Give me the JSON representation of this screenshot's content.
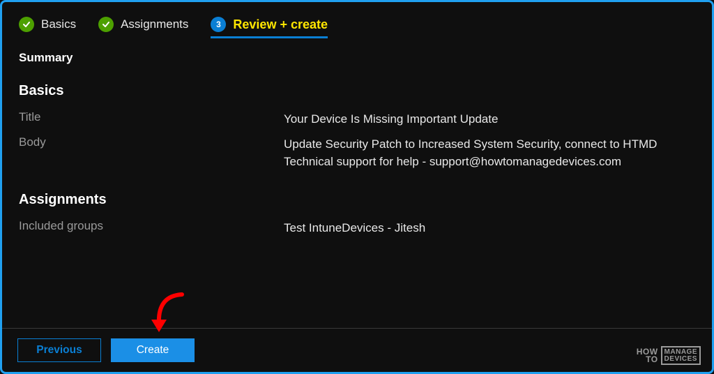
{
  "steps": {
    "basics": "Basics",
    "assignments": "Assignments",
    "review": "Review + create",
    "active_num": "3"
  },
  "summary": {
    "heading": "Summary",
    "basics_section": "Basics",
    "title_label": "Title",
    "title_value": "Your Device Is Missing Important Update",
    "body_label": "Body",
    "body_value": "Update Security Patch to Increased System Security, connect to HTMD Technical support for help - support@howtomanagedevices.com",
    "assignments_section": "Assignments",
    "included_label": "Included groups",
    "included_value": "Test IntuneDevices - Jitesh"
  },
  "footer": {
    "previous": "Previous",
    "create": "Create"
  },
  "watermark": {
    "left_1": "HOW",
    "left_2": "TO",
    "right_1": "MANAGE",
    "right_2": "DEVICES"
  },
  "colors": {
    "frame_border": "#20a0f0",
    "accent": "#0a7fd4",
    "active_text": "#ffe600",
    "check_green": "#4da000",
    "arrow": "#ff0000"
  }
}
